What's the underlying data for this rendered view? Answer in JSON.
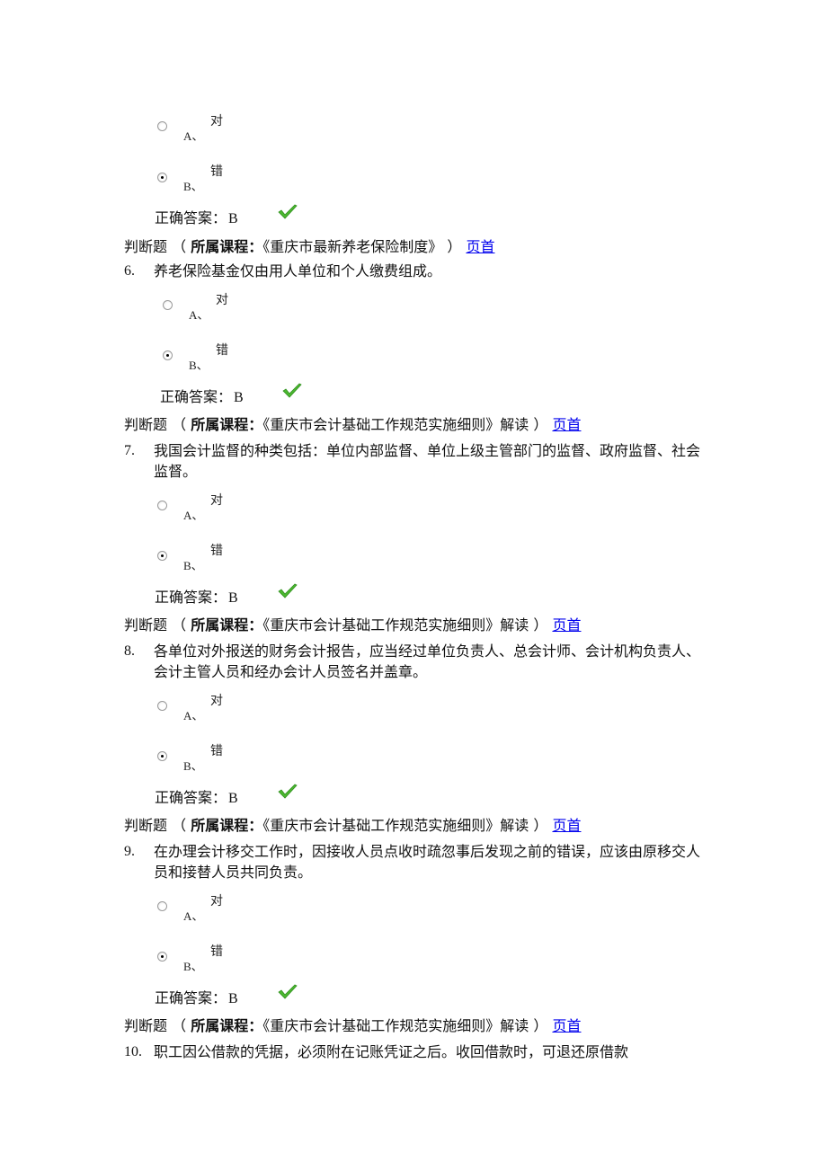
{
  "blocks": [
    {
      "options": [
        {
          "letter": "A、",
          "text": "对",
          "selected": false
        },
        {
          "letter": "B、",
          "text": "错",
          "selected": true
        }
      ],
      "answer_label": "正确答案：",
      "answer_value": "B",
      "result_icon": "checkmark-icon"
    },
    {
      "meta": {
        "type": "判断题",
        "open_paren": "（",
        "course_label": "所属课程：",
        "course_name": "《重庆市最新养老保险制度》",
        "close_paren": "）",
        "link": "页首"
      },
      "number": "6.",
      "question": "养老保险基金仅由用人单位和个人缴费组成。",
      "options": [
        {
          "letter": "A、",
          "text": "对",
          "selected": false
        },
        {
          "letter": "B、",
          "text": "错",
          "selected": true
        }
      ],
      "answer_label": "正确答案：",
      "answer_value": "B",
      "result_icon": "checkmark-icon"
    },
    {
      "meta": {
        "type": "判断题",
        "open_paren": "（",
        "course_label": "所属课程：",
        "course_name": "《重庆市会计基础工作规范实施细则》解读",
        "close_paren": "）",
        "link": "页首"
      },
      "number": "7.",
      "question": "我国会计监督的种类包括：单位内部监督、单位上级主管部门的监督、政府监督、社会监督。",
      "options": [
        {
          "letter": "A、",
          "text": "对",
          "selected": false
        },
        {
          "letter": "B、",
          "text": "错",
          "selected": true
        }
      ],
      "answer_label": "正确答案：",
      "answer_value": "B",
      "result_icon": "checkmark-icon"
    },
    {
      "meta": {
        "type": "判断题",
        "open_paren": "（",
        "course_label": "所属课程：",
        "course_name": "《重庆市会计基础工作规范实施细则》解读",
        "close_paren": "）",
        "link": "页首"
      },
      "number": "8.",
      "question": "各单位对外报送的财务会计报告，应当经过单位负责人、总会计师、会计机构负责人、会计主管人员和经办会计人员签名并盖章。",
      "options": [
        {
          "letter": "A、",
          "text": "对",
          "selected": false
        },
        {
          "letter": "B、",
          "text": "错",
          "selected": true
        }
      ],
      "answer_label": "正确答案：",
      "answer_value": "B",
      "result_icon": "checkmark-icon"
    },
    {
      "meta": {
        "type": "判断题",
        "open_paren": "（",
        "course_label": "所属课程：",
        "course_name": "《重庆市会计基础工作规范实施细则》解读",
        "close_paren": "）",
        "link": "页首"
      },
      "number": "9.",
      "question": "在办理会计移交工作时，因接收人员点收时疏忽事后发现之前的错误，应该由原移交人员和接替人员共同负责。",
      "options": [
        {
          "letter": "A、",
          "text": "对",
          "selected": false
        },
        {
          "letter": "B、",
          "text": "错",
          "selected": true
        }
      ],
      "answer_label": "正确答案：",
      "answer_value": "B",
      "result_icon": "checkmark-icon"
    },
    {
      "meta": {
        "type": "判断题",
        "open_paren": "（",
        "course_label": "所属课程：",
        "course_name": "《重庆市会计基础工作规范实施细则》解读",
        "close_paren": "）",
        "link": "页首"
      },
      "number": "10.",
      "question": "职工因公借款的凭据，必须附在记账凭证之后。收回借款时，可退还原借款"
    }
  ],
  "colors": {
    "link": "#0000ee",
    "check": "#4cb830"
  }
}
